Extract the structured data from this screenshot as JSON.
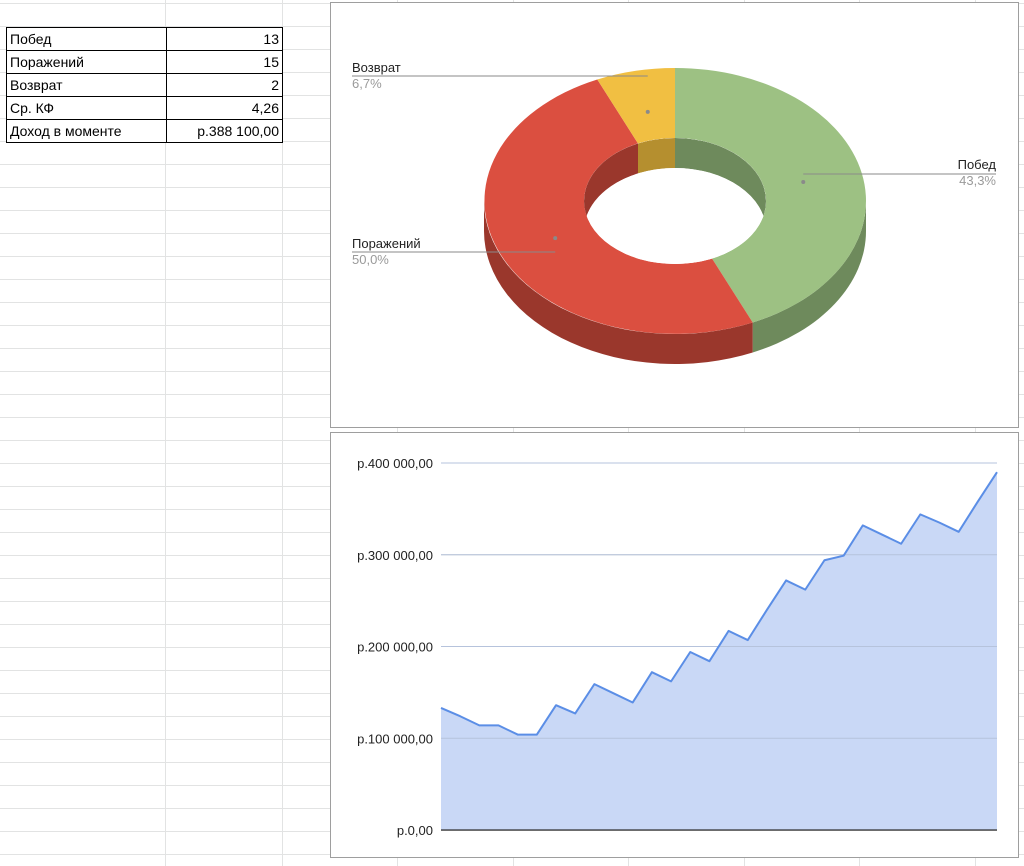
{
  "stats": [
    {
      "label": "Побед",
      "value": "13"
    },
    {
      "label": "Поражений",
      "value": "15"
    },
    {
      "label": "Возврат",
      "value": "2"
    },
    {
      "label": "Ср.  КФ",
      "value": "4,26"
    },
    {
      "label": "Доход в моменте",
      "value": "р.388 100,00"
    }
  ],
  "chart_data": [
    {
      "type": "pie",
      "style": "3d-donut",
      "legend": "labels beside slices",
      "slices": [
        {
          "label": "Побед",
          "value": 13,
          "percent_label": "43,3%",
          "color": "#9dc183",
          "side_color": "#6e8a5c"
        },
        {
          "label": "Поражений",
          "value": 15,
          "percent_label": "50,0%",
          "color": "#db4f40",
          "side_color": "#9a372c"
        },
        {
          "label": "Возврат",
          "value": 2,
          "percent_label": "6,7%",
          "color": "#f1bf42",
          "side_color": "#b58f2f"
        }
      ]
    },
    {
      "type": "area",
      "grid": true,
      "ylim": [
        0,
        400000
      ],
      "yticks": [
        "р.0,00",
        "р.100 000,00",
        "р.200 000,00",
        "р.300 000,00",
        "р.400 000,00"
      ],
      "color": "#5b8ee6",
      "fill_color": "#c9d8f6",
      "values": [
        133000,
        124000,
        114000,
        114000,
        104000,
        104000,
        136000,
        127000,
        159000,
        149000,
        139000,
        172000,
        162000,
        194000,
        184000,
        217000,
        207000,
        240000,
        272000,
        262000,
        294000,
        299000,
        332000,
        322000,
        312000,
        344000,
        335000,
        325000,
        358000,
        390000
      ]
    }
  ]
}
